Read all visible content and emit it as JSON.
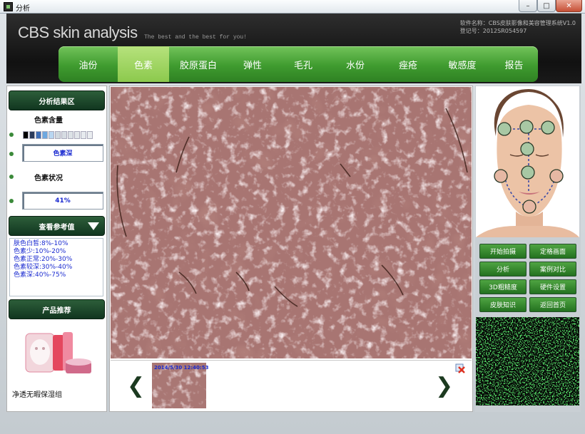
{
  "window": {
    "title": "分析"
  },
  "header": {
    "logo": "CBS skin analysis",
    "tagline": "The best and the best for you!",
    "software_name": "软件名称：CBS皮肤影像和美容管理系统V1.0",
    "registration": "登记号：2012SR054597"
  },
  "nav": {
    "tabs": [
      {
        "label": "油份",
        "active": false
      },
      {
        "label": "色素",
        "active": true
      },
      {
        "label": "胶原蛋白",
        "active": false
      },
      {
        "label": "弹性",
        "active": false
      },
      {
        "label": "毛孔",
        "active": false
      },
      {
        "label": "水份",
        "active": false
      },
      {
        "label": "痤疮",
        "active": false
      },
      {
        "label": "敏感度",
        "active": false
      },
      {
        "label": "报告",
        "active": false
      }
    ]
  },
  "left": {
    "result_header": "分析结果区",
    "pigment_amount_label": "色素含量",
    "pigment_scale_colors": [
      "#000000",
      "#2b3a5a",
      "#3f6fb8",
      "#6fa8e0",
      "#b8d6f0",
      "#d0d8de",
      "#d6dce2",
      "#dce2e6",
      "#e2e6ea",
      "#e6eaee",
      "#eaedf0",
      "#eef0f2"
    ],
    "pigment_value": "色素深",
    "pigment_status_label": "色素状况",
    "pigment_status_value": "41%",
    "reference_header": "查看参考值",
    "reference_items": [
      "肤色白皙:8%-10%",
      "色素少:10%-20%",
      "色素正常:20%-30%",
      "色素较深:30%-40%",
      "色素深:40%-75%"
    ],
    "product_header": "产品推荐",
    "product_name": "净透无暇保湿组"
  },
  "center": {
    "thumbnail_timestamp": "2014/5/30 12:40:53"
  },
  "right": {
    "buttons": [
      "开始拍摄",
      "定格画面",
      "分析",
      "案例对比",
      "3D粗糙度",
      "硬件设置",
      "皮肤知识",
      "返回首页"
    ]
  },
  "icons": [
    "app-icon",
    "minimize-icon",
    "maximize-icon",
    "close-icon",
    "dropdown-triangle-icon",
    "chevron-left-icon",
    "chevron-right-icon",
    "delete-icon"
  ],
  "colors": {
    "header_bg": "#161616",
    "nav_green": "#4da63a",
    "nav_active": "#9fd35f",
    "panel_dark_green": "#18402a",
    "value_text": "#1a2ad0"
  }
}
